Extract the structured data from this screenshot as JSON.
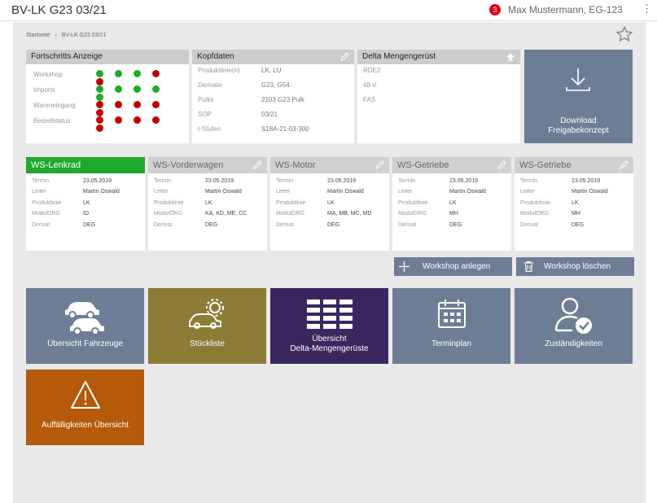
{
  "header": {
    "title": "BV-LK G23 03/21",
    "notification_count": "3",
    "user": "Max Mustermann, EG-123"
  },
  "breadcrumb": {
    "home": "Startseite",
    "separator": "›",
    "current": "BV-LK G23 03/21"
  },
  "progress": {
    "title": "Fortschritts Anzeige",
    "colors": {
      "green": "#1faa2e",
      "red": "#c00000"
    },
    "rows": [
      {
        "label": "Workshop",
        "dots": [
          "green",
          "green",
          "green",
          "red",
          "red"
        ]
      },
      {
        "label": "Imports",
        "dots": [
          "green",
          "green",
          "green",
          "green",
          "green"
        ]
      },
      {
        "label": "Wareneingang",
        "dots": [
          "red",
          "red",
          "red",
          "red",
          "red"
        ]
      },
      {
        "label": "Bestellstatus",
        "dots": [
          "red",
          "red",
          "red",
          "red",
          "red"
        ]
      }
    ]
  },
  "kopf": {
    "title": "Kopfdaten",
    "rows": [
      {
        "k": "Produktlinie(n)",
        "v": "LK, LU"
      },
      {
        "k": "Derivate",
        "v": "G23, G54"
      },
      {
        "k": "Pulks",
        "v": "2103 G23 Pulk"
      },
      {
        "k": "SOP",
        "v": "03/21"
      },
      {
        "k": "I-Stufen",
        "v": "S18A-21-03-300"
      }
    ]
  },
  "delta": {
    "title": "Delta Mengengerüst",
    "items": [
      "RDE2",
      "48 V",
      "FAS"
    ]
  },
  "download": {
    "label1": "Download",
    "label2": "Freigabekonzept",
    "bg": "#6e7d96"
  },
  "ws_labels": {
    "termin": "Termin",
    "leiter": "Leiter",
    "produktlinie": "Produktlinie",
    "modulorg": "ModulORG",
    "derivat": "Derivat"
  },
  "workshops": [
    {
      "title": "WS-Lenkrad",
      "termin": "23.05.2019",
      "leiter": "Martin Oswald",
      "produktlinie": "LK",
      "modulorg": "ID",
      "derivat": "DEG"
    },
    {
      "title": "WS-Vorderwagen",
      "termin": "23.05.2019",
      "leiter": "Martin Oswald",
      "produktlinie": "LK",
      "modulorg": "KA, KD, ME, CC",
      "derivat": "DEG"
    },
    {
      "title": "WS-Motor",
      "termin": "23.05.2019",
      "leiter": "Martin Oswald",
      "produktlinie": "LK",
      "modulorg": "MA, MB, MC, MD",
      "derivat": "DEG"
    },
    {
      "title": "WS-Getriebe",
      "termin": "23.05.2019",
      "leiter": "Martin Oswald",
      "produktlinie": "LK",
      "modulorg": "MH",
      "derivat": "DEG"
    },
    {
      "title": "WS-Getriebe",
      "termin": "23.05.2019",
      "leiter": "Martin Oswald",
      "produktlinie": "LK",
      "modulorg": "MH",
      "derivat": "DEG"
    }
  ],
  "actions": {
    "add": "Workshop anlegen",
    "delete": "Workshop löschen"
  },
  "tiles": [
    {
      "label": "Übersicht Fahrzeuge",
      "bg": "#6e7d96",
      "icon": "cars-icon"
    },
    {
      "label": "Stückliste",
      "bg": "#8c7b35",
      "icon": "car-gear-icon"
    },
    {
      "label": "Übersicht",
      "label2": "Delta-Mengengerüste",
      "bg": "#3a2760",
      "icon": "table-icon"
    },
    {
      "label": "Terminplan",
      "bg": "#6e7d96",
      "icon": "calendar-icon"
    },
    {
      "label": "Zuständigkeiten",
      "bg": "#6e7d96",
      "icon": "user-check-icon"
    },
    {
      "label": "Auffälligkeiten Übersicht",
      "bg": "#b45a0a",
      "icon": "warning-icon"
    }
  ]
}
